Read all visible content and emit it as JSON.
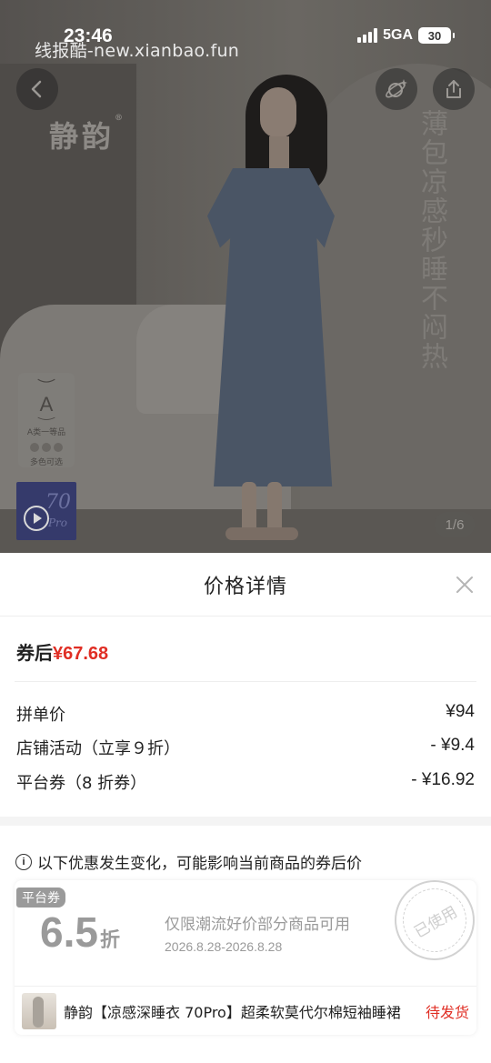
{
  "status_bar": {
    "time": "23:46",
    "network": "5GA",
    "battery": "30"
  },
  "watermark": "线报酷-new.xianbao.fun",
  "hero": {
    "brand": "静韵",
    "brand_mark": "®",
    "slogan": "薄包凉感秒睡不闷热",
    "grade_letter": "A",
    "grade_text": "A类一等品",
    "color_text": "多色可选",
    "video_number": "70",
    "video_suffix": "Pro",
    "page_indicator": "1/6",
    "icons": {
      "back": "chevron-left-icon",
      "ar": "ar-view-icon",
      "share": "share-icon"
    }
  },
  "sheet": {
    "title": "价格详情",
    "after_coupon_label": "券后",
    "after_coupon_price": "¥67.68",
    "rows": [
      {
        "label": "拼单价",
        "amount": "¥94"
      },
      {
        "label": "店铺活动（立享９折）",
        "amount": "- ¥9.4"
      },
      {
        "label": "平台券（8 折券）",
        "amount": "- ¥16.92"
      }
    ],
    "notice": "以下优惠发生变化，可能影响当前商品的券后价",
    "coupon": {
      "tag": "平台券",
      "discount": "6.5",
      "unit": "折",
      "desc": "仅限潮流好价部分商品可用",
      "date": "2026.8.28-2026.8.28",
      "stamp": "已使用"
    },
    "product": {
      "name": "静韵【凉感深睡衣 70Pro】超柔软莫代尔棉短袖睡裙",
      "status": "待发货"
    }
  },
  "colors": {
    "accent_red": "#e02e24",
    "muted_gray": "#9a9a9a"
  }
}
